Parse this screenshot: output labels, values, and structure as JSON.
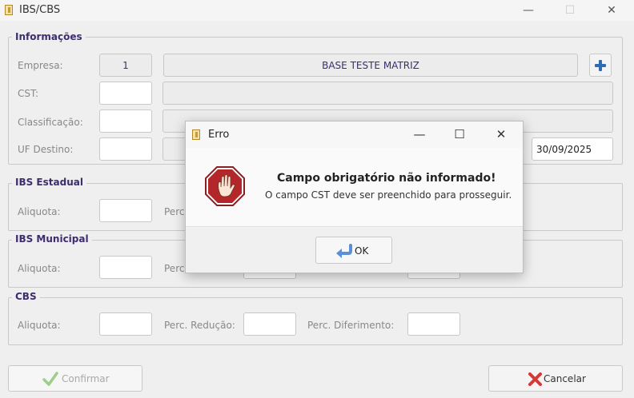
{
  "window": {
    "title": "IBS/CBS",
    "minimize": "—",
    "maximize": "☐",
    "close": "✕"
  },
  "informacoes": {
    "legend": "Informações",
    "empresa_label": "Empresa:",
    "empresa_code": "1",
    "empresa_name": "BASE TESTE MATRIZ",
    "cst_label": "CST:",
    "classificacao_label": "Classificação:",
    "uf_destino_label": "UF Destino:",
    "date": "30/09/2025",
    "add_icon": "plus-icon"
  },
  "ibs_estadual": {
    "legend": "IBS Estadual",
    "aliquota_label": "Aliquota:",
    "perc_label": "Perc."
  },
  "ibs_municipal": {
    "legend": "IBS Municipal",
    "aliquota_label": "Aliquota:",
    "perc_label": "Perc."
  },
  "cbs": {
    "legend": "CBS",
    "aliquota_label": "Aliquota:",
    "reducao_label": "Perc. Redução:",
    "diferimento_label": "Perc. Diferimento:"
  },
  "footer": {
    "confirm_label": "Confirmar",
    "cancel_label": "Cancelar"
  },
  "dialog": {
    "title": "Erro",
    "minimize": "—",
    "maximize": "☐",
    "close": "✕",
    "heading": "Campo obrigatório não informado!",
    "message": "O campo CST deve ser preenchido para prosseguir.",
    "ok_label": "OK",
    "icon": "stop-hand-icon",
    "colors": {
      "stop_red": "#b3262a",
      "title_purple": "#3d2d6e"
    }
  }
}
